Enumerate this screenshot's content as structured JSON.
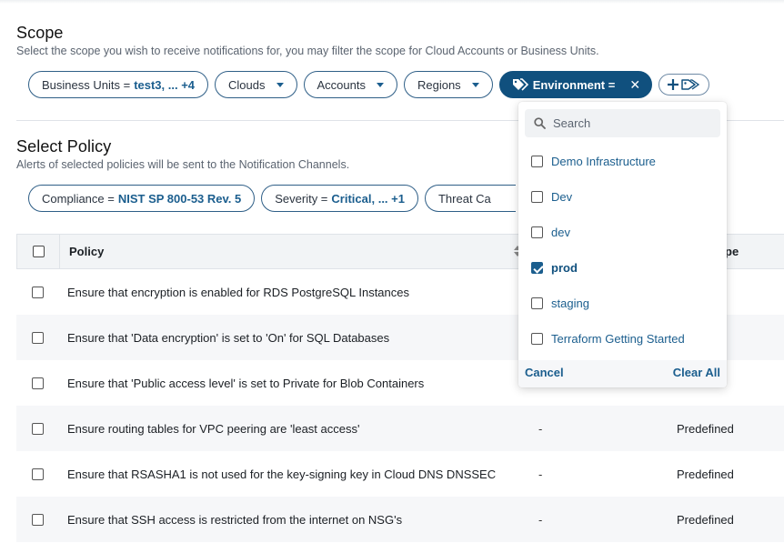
{
  "scope": {
    "title": "Scope",
    "subtitle": "Select the scope you wish to receive notifications for, you may filter the scope for Cloud Accounts or Business Units.",
    "filters": {
      "business_units": {
        "label": "Business Units =",
        "value": "test3, ... +4"
      },
      "clouds": {
        "label": "Clouds"
      },
      "accounts": {
        "label": "Accounts"
      },
      "regions": {
        "label": "Regions"
      },
      "environment": {
        "label": "Environment ="
      }
    }
  },
  "policy": {
    "title": "Select Policy",
    "subtitle": "Alerts of selected policies will be sent to the Notification Channels.",
    "filters": {
      "compliance": {
        "label": "Compliance =",
        "value": "NIST SP 800-53 Rev. 5"
      },
      "severity": {
        "label": "Severity =",
        "value": "Critical, ... +1"
      },
      "threat": {
        "label": "Threat Ca"
      }
    }
  },
  "table": {
    "headers": {
      "policy": "Policy",
      "type": "pe"
    },
    "rows": [
      {
        "policy": "Ensure that encryption is enabled for RDS PostgreSQL Instances",
        "col3": "",
        "type": "ed"
      },
      {
        "policy": "Ensure that 'Data encryption' is set to 'On' for SQL Databases",
        "col3": "",
        "type": "ed"
      },
      {
        "policy": "Ensure that 'Public access level' is set to Private for Blob Containers",
        "col3": "",
        "type": "ed"
      },
      {
        "policy": "Ensure routing tables for VPC peering are 'least access'",
        "col3": "-",
        "type": "Predefined"
      },
      {
        "policy": "Ensure that RSASHA1 is not used for the key-signing key in Cloud DNS DNSSEC",
        "col3": "-",
        "type": "Predefined"
      },
      {
        "policy": "Ensure that SSH access is restricted from the internet on NSG's",
        "col3": "-",
        "type": "Predefined"
      }
    ]
  },
  "dropdown": {
    "search_placeholder": "Search",
    "options": [
      {
        "label": "Demo Infrastructure",
        "checked": false
      },
      {
        "label": "Dev",
        "checked": false
      },
      {
        "label": "dev",
        "checked": false
      },
      {
        "label": "prod",
        "checked": true
      },
      {
        "label": "staging",
        "checked": false
      },
      {
        "label": "Terraform Getting Started",
        "checked": false
      }
    ],
    "cancel_label": "Cancel",
    "clear_label": "Clear All"
  },
  "colors": {
    "accent": "#10507e",
    "link": "#1b5e8e"
  }
}
